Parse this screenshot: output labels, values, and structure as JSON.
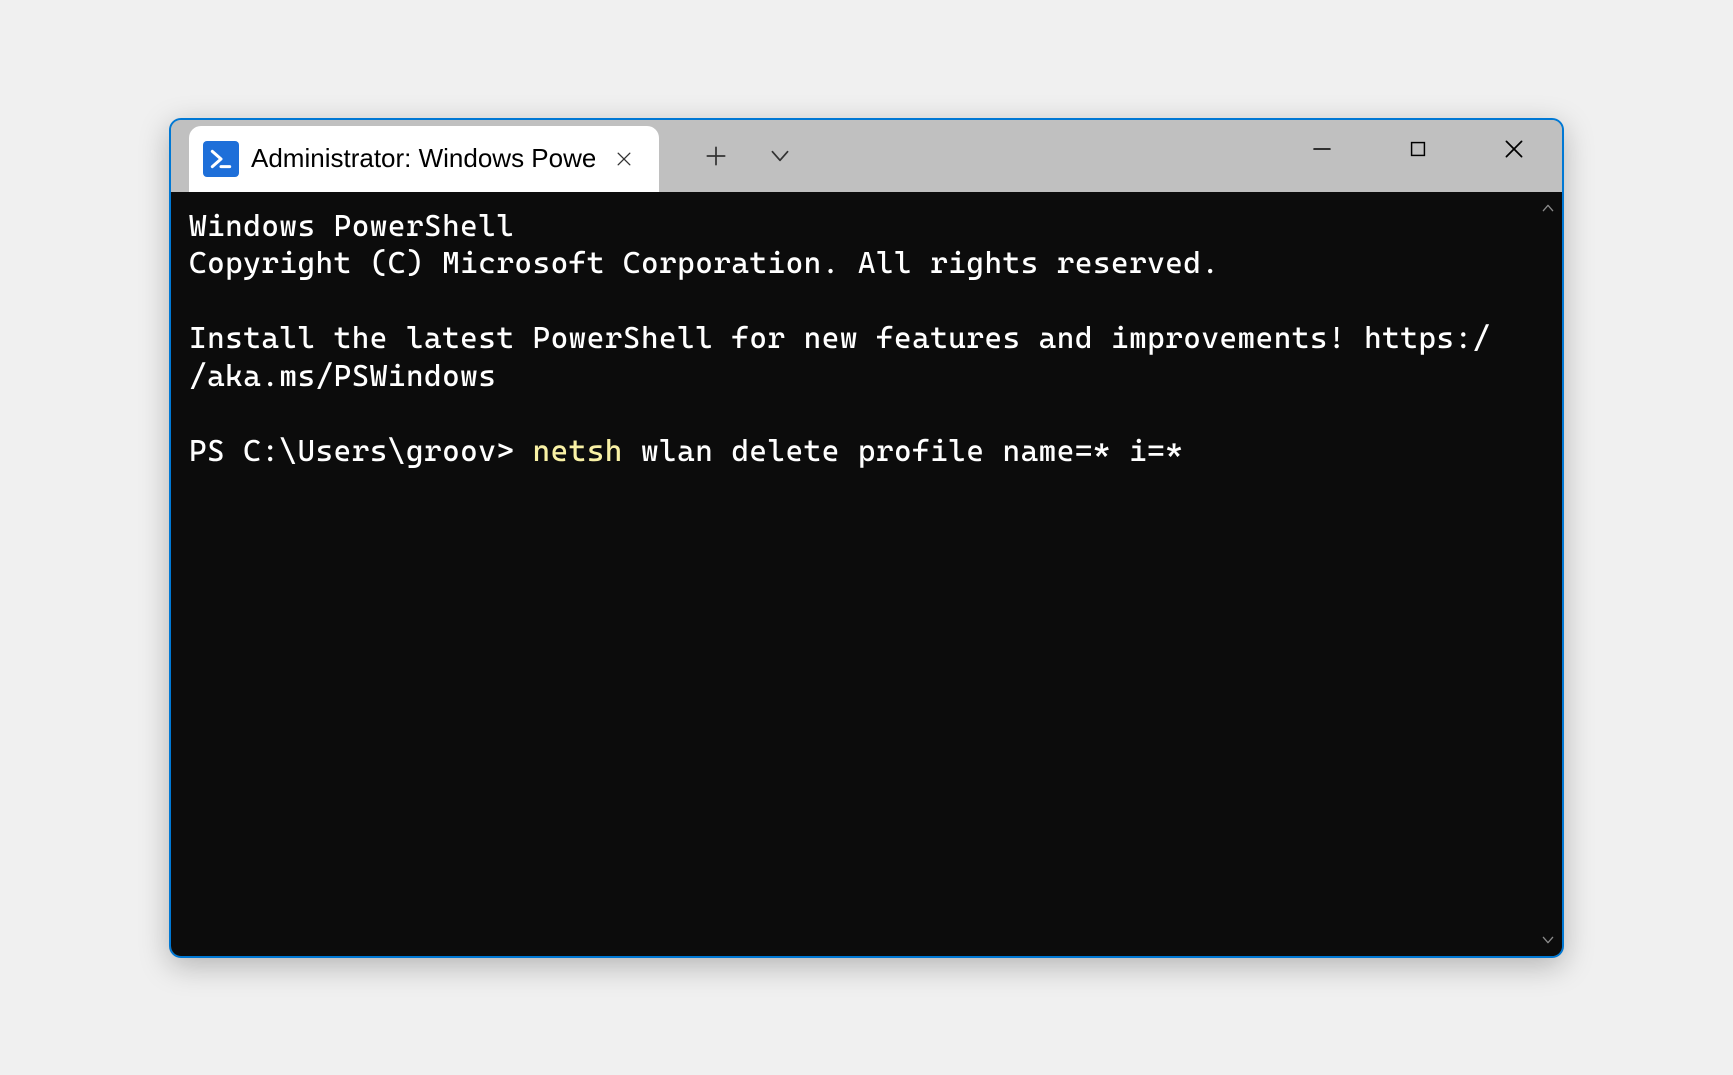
{
  "tab": {
    "title": "Administrator: Windows PowerS",
    "icon": "powershell-icon"
  },
  "terminal": {
    "line1": "Windows PowerShell",
    "line2": "Copyright (C) Microsoft Corporation. All rights reserved.",
    "line3a": "Install the latest PowerShell for new features and improvements! https:/",
    "line3b": "/aka.ms/PSWindows",
    "prompt": "PS C:\\Users\\groov> ",
    "cmd_kw": "netsh",
    "cmd_rest": " wlan delete profile name=* i=*"
  }
}
